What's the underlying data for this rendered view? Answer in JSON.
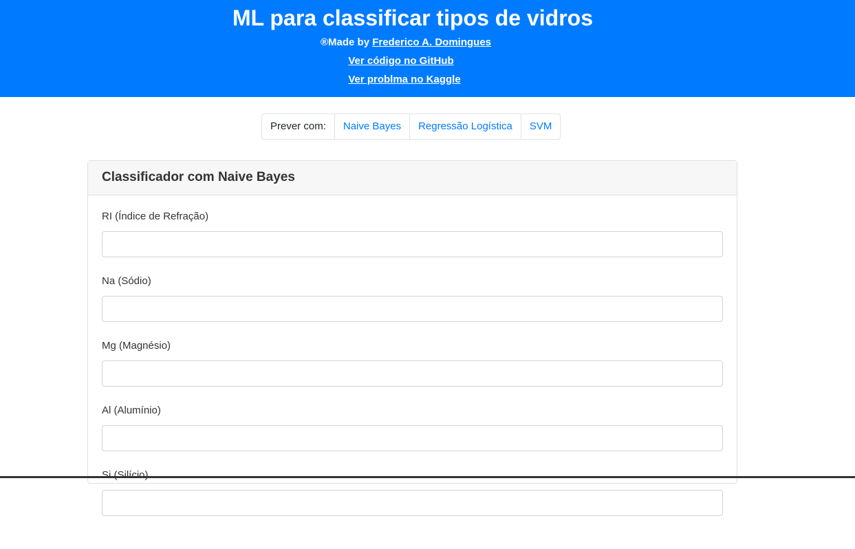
{
  "header": {
    "title": "ML para classificar tipos de vidros",
    "made_by_prefix": "®Made by ",
    "author": "Frederico A. Domingues",
    "github_link": "Ver código no GitHub",
    "kaggle_link": "Ver problma no Kaggle"
  },
  "nav": {
    "label": "Prever com:",
    "items": [
      "Naive Bayes",
      "Regressão Logística",
      "SVM"
    ]
  },
  "card": {
    "title": "Classificador com Naive Bayes",
    "fields": [
      {
        "label": "RI (Índice de Refração)",
        "value": ""
      },
      {
        "label": "Na (Sódio)",
        "value": ""
      },
      {
        "label": "Mg (Magnésio)",
        "value": ""
      },
      {
        "label": "Al (Alumínio)",
        "value": ""
      },
      {
        "label": "Si (Silício)",
        "value": ""
      }
    ]
  }
}
